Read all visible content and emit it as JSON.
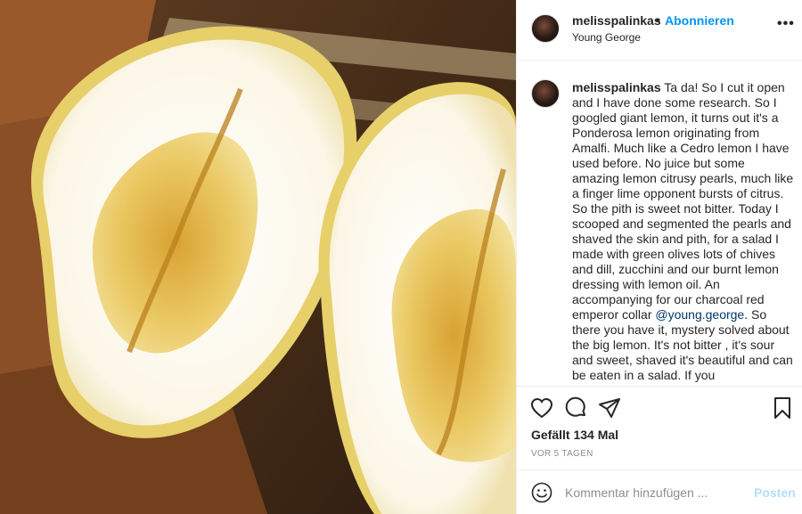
{
  "post": {
    "username": "melisspalinkas",
    "separator": "•",
    "follow_label": "Abonnieren",
    "location": "Young George",
    "more_label": "•••"
  },
  "caption": {
    "username": "melisspalinkas",
    "text_before_mention": "Ta da! So I cut it open and I have done some research. So I googled giant lemon, it turns out it's a Ponderosa lemon originating from Amalfi. Much like a Cedro lemon I have used before. No juice but some amazing lemon citrusy pearls, much like a finger lime opponent bursts of citrus. So the pith is sweet not bitter. Today I scooped and segmented the pearls and shaved the skin and pith, for a salad I made with green olives lots of chives and dill, zucchini and our burnt lemon dressing with lemon oil. An accompanying for our charcoal red emperor collar ",
    "mention": "@young.george",
    "text_after_mention": ". So there you have it, mystery solved about the big lemon. It's not bitter , it's sour and sweet, shaved it's beautiful and can be eaten in a salad. If you"
  },
  "actions": {
    "icons": [
      "heart-icon",
      "comment-icon",
      "share-icon",
      "bookmark-icon"
    ],
    "likes": "Gefällt 134 Mal",
    "time_ago": "VOR 5 TAGEN"
  },
  "comment": {
    "placeholder": "Kommentar hinzufügen ...",
    "post_label": "Posten"
  },
  "colors": {
    "link_blue": "#0095f6",
    "post_disabled": "#b2dffc",
    "mention": "#00376b",
    "muted": "#8e8e8e"
  }
}
